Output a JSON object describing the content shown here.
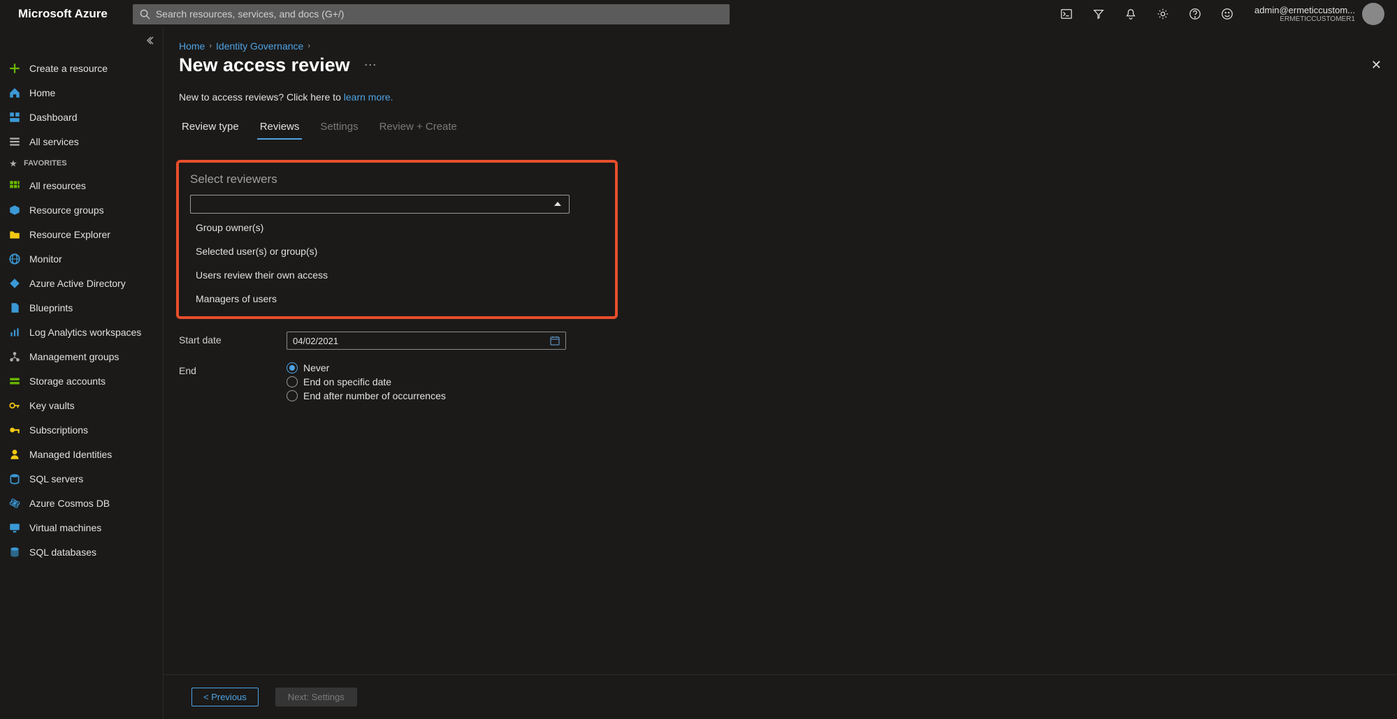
{
  "brand": "Microsoft Azure",
  "search": {
    "placeholder": "Search resources, services, and docs (G+/)"
  },
  "account": {
    "email": "admin@ermeticcustom...",
    "tenant": "ERMETICCUSTOMER1"
  },
  "sidebar": {
    "top": [
      {
        "label": "Create a resource",
        "icon": "plus",
        "color": "#6bb700"
      },
      {
        "label": "Home",
        "icon": "home",
        "color": "#3b99d6"
      },
      {
        "label": "Dashboard",
        "icon": "dashboard",
        "color": "#3b99d6"
      },
      {
        "label": "All services",
        "icon": "list",
        "color": "#b0b0b0"
      }
    ],
    "fav_header": "FAVORITES",
    "favorites": [
      {
        "label": "All resources",
        "icon": "grid",
        "color": "#6bb700"
      },
      {
        "label": "Resource groups",
        "icon": "cube",
        "color": "#3b99d6"
      },
      {
        "label": "Resource Explorer",
        "icon": "folder",
        "color": "#f2c811"
      },
      {
        "label": "Monitor",
        "icon": "globe",
        "color": "#3b99d6"
      },
      {
        "label": "Azure Active Directory",
        "icon": "diamond",
        "color": "#3b99d6"
      },
      {
        "label": "Blueprints",
        "icon": "doc",
        "color": "#3b99d6"
      },
      {
        "label": "Log Analytics workspaces",
        "icon": "analytics",
        "color": "#3b99d6"
      },
      {
        "label": "Management groups",
        "icon": "mgmt",
        "color": "#b0b0b0"
      },
      {
        "label": "Storage accounts",
        "icon": "storage",
        "color": "#6bb700"
      },
      {
        "label": "Key vaults",
        "icon": "key",
        "color": "#f2c811"
      },
      {
        "label": "Subscriptions",
        "icon": "keysolid",
        "color": "#f2c811"
      },
      {
        "label": "Managed Identities",
        "icon": "identity",
        "color": "#f2c811"
      },
      {
        "label": "SQL servers",
        "icon": "sql",
        "color": "#3b99d6"
      },
      {
        "label": "Azure Cosmos DB",
        "icon": "cosmos",
        "color": "#3b99d6"
      },
      {
        "label": "Virtual machines",
        "icon": "vm",
        "color": "#3b99d6"
      },
      {
        "label": "SQL databases",
        "icon": "sqldb",
        "color": "#3b99d6"
      }
    ]
  },
  "breadcrumbs": [
    {
      "label": "Home"
    },
    {
      "label": "Identity Governance"
    }
  ],
  "page": {
    "title": "New access review",
    "intro_prefix": "New to access reviews? Click here to ",
    "intro_link": "learn more."
  },
  "tabs": [
    {
      "label": "Review type",
      "state": "normal"
    },
    {
      "label": "Reviews",
      "state": "active"
    },
    {
      "label": "Settings",
      "state": "dim"
    },
    {
      "label": "Review + Create",
      "state": "dim"
    }
  ],
  "reviewers": {
    "section_label": "Select reviewers",
    "options": [
      "Group owner(s)",
      "Selected user(s) or group(s)",
      "Users review their own access",
      "Managers of users"
    ]
  },
  "form": {
    "start_date_label": "Start date",
    "start_date_value": "04/02/2021",
    "end_label": "End",
    "end_options": [
      {
        "label": "Never",
        "checked": true
      },
      {
        "label": "End on specific date",
        "checked": false
      },
      {
        "label": "End after number of occurrences",
        "checked": false
      }
    ]
  },
  "footer": {
    "prev": "< Previous",
    "next": "Next: Settings"
  }
}
